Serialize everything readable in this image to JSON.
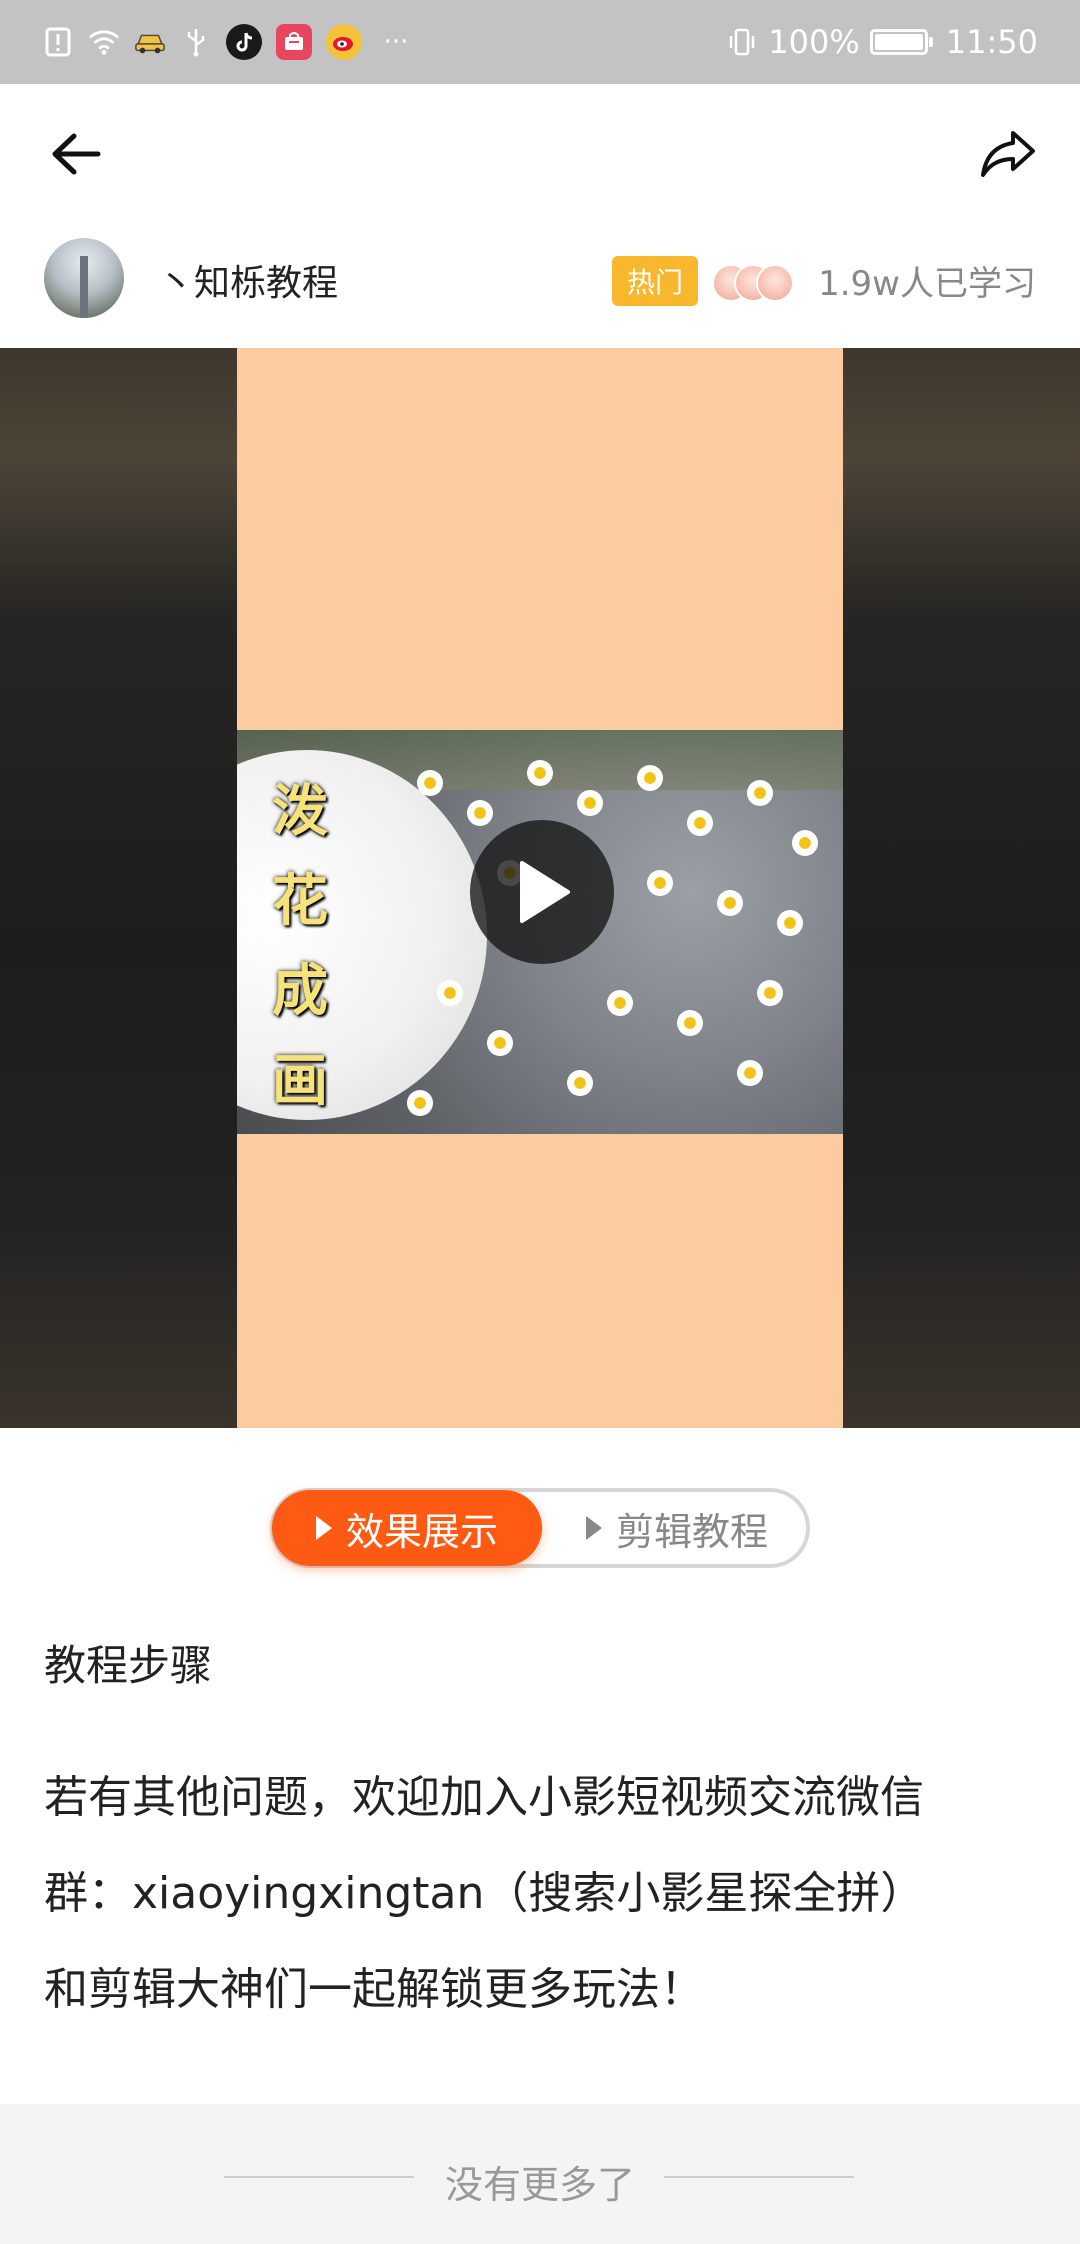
{
  "status_bar": {
    "battery": "100%",
    "time": "11:50",
    "more": "···"
  },
  "icons": {
    "back": "back-arrow-icon",
    "share": "share-icon",
    "play": "play-icon"
  },
  "author": {
    "name": "丶知栎教程",
    "hot_badge": "热门",
    "learned_count": "1.9w人已学习"
  },
  "video": {
    "overlay_title": [
      "泼",
      "花",
      "成",
      "画"
    ]
  },
  "tabs": {
    "effect": "效果展示",
    "tutorial": "剪辑教程",
    "active": "效果展示"
  },
  "steps": {
    "title": "教程步骤",
    "lines": [
      "若有其他问题，欢迎加入小影短视频交流微信",
      "群：xiaoyingxingtan（搜索小影星探全拼）",
      "和剪辑大神们一起解锁更多玩法！"
    ]
  },
  "footer": {
    "text": "没有更多了"
  },
  "colors": {
    "accent": "#ff5a14",
    "hot": "#f9b72e",
    "video_bg": "#fdcba0"
  }
}
